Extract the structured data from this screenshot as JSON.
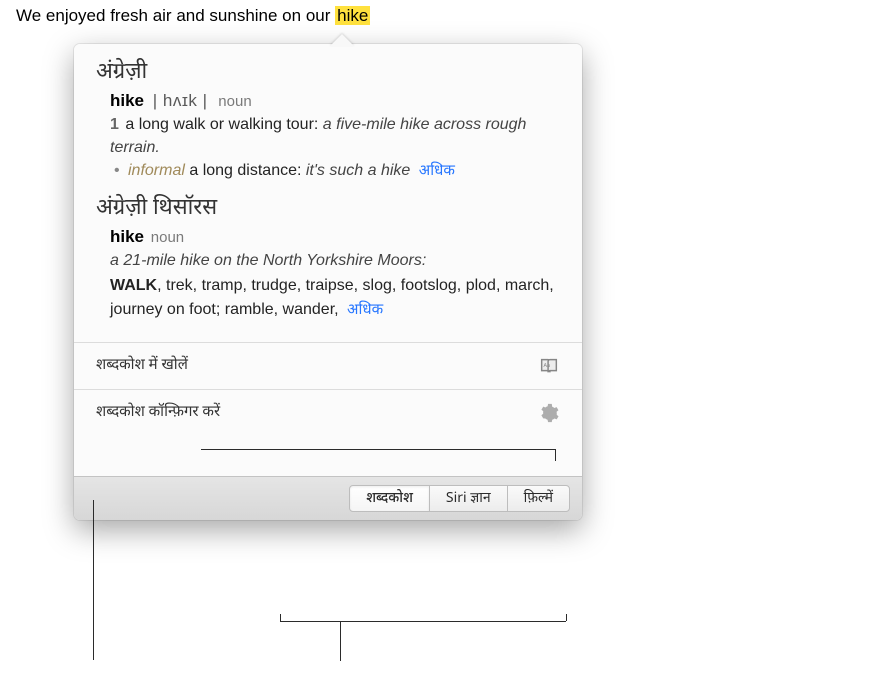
{
  "sentence": {
    "prefix": "We enjoyed fresh air and sunshine on our ",
    "highlight": "hike"
  },
  "dictionary": {
    "title": "अंग्रेज़ी",
    "headword": "hike",
    "pronunciation": "| hʌɪk |",
    "part_of_speech": "noun",
    "def_number": "1",
    "definition": "a long walk or walking tour: ",
    "example": "a five-mile hike across rough terrain.",
    "informal_label": "informal",
    "informal_def": " a long distance: ",
    "informal_example": "it's such a hike",
    "more_label": "अधिक"
  },
  "thesaurus": {
    "title": "अंग्रेज़ी थिसॉरस",
    "headword": "hike",
    "part_of_speech": "noun",
    "example": "a 21-mile hike on the North Yorkshire Moors:",
    "syn_lead": "WALK",
    "synonyms": ", trek, tramp, trudge, traipse, slog, footslog, plod, march, journey on foot; ramble, wander, ",
    "more_label": "अधिक"
  },
  "actions": {
    "open_label": "शब्दकोश में खोलें",
    "configure_label": "शब्दकोश कॉन्फ़िगर करें"
  },
  "tabs": {
    "dictionary": "शब्दकोश",
    "siri": "Siri ज्ञान",
    "movies": "फ़िल्में"
  }
}
